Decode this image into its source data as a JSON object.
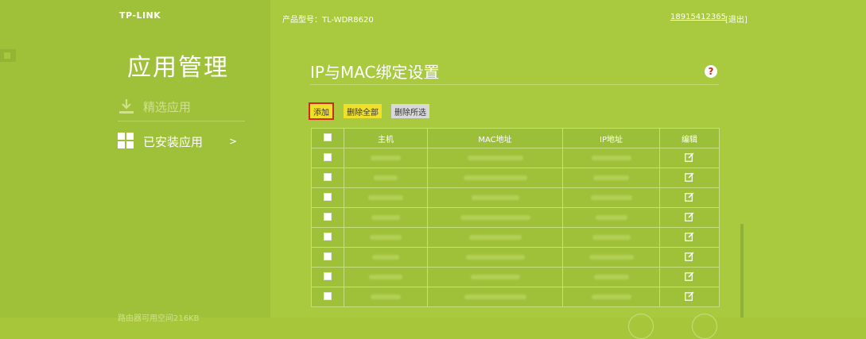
{
  "header": {
    "logo": "TP-LINK",
    "model_label": "产品型号：TL-WDR8620",
    "phone": "18915412365",
    "logout": "[退出]"
  },
  "sidebar": {
    "title": "应用管理",
    "items": [
      {
        "label": "精选应用",
        "icon": "download-icon"
      },
      {
        "label": "已安装应用",
        "icon": "grid-icon",
        "arrow": ">"
      }
    ],
    "storage_note": "路由器可用空间216KB"
  },
  "main": {
    "title": "IP与MAC绑定设置",
    "help": "?",
    "buttons": {
      "add": "添加",
      "delete_all": "删除全部",
      "delete_selected": "删除所选"
    },
    "table": {
      "columns": [
        "",
        "主机",
        "MAC地址",
        "IP地址",
        "编辑"
      ],
      "row_count": 8
    }
  },
  "colors": {
    "left_bg": "#9fc13a",
    "right_bg": "#a9c93f",
    "accent_yellow": "#f1e02a",
    "highlight_red": "#d12a1f"
  }
}
